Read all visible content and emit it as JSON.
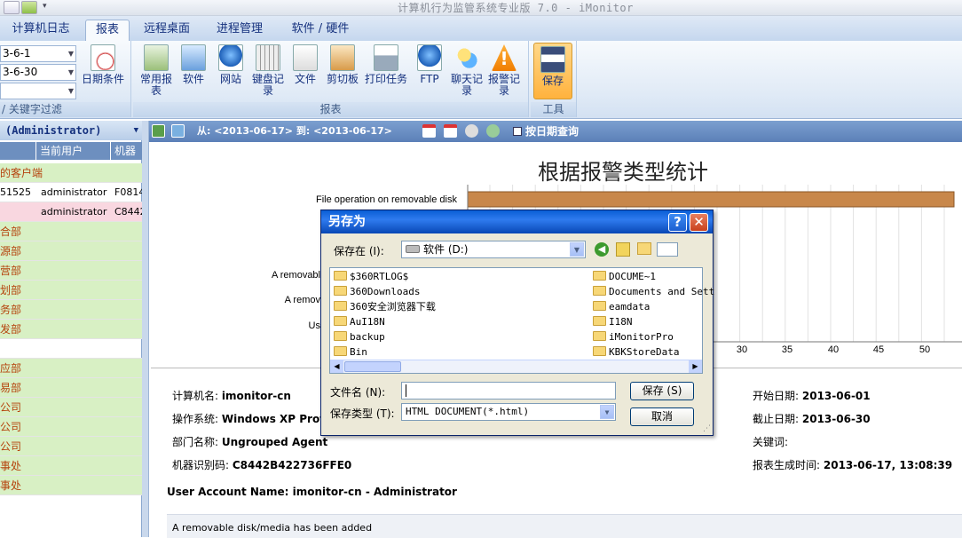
{
  "window": {
    "title": "计算机行为监管系统专业版 7.0 - iMonitor"
  },
  "tabs": [
    "计算机日志",
    "报表",
    "远程桌面",
    "进程管理",
    "软件 / 硬件"
  ],
  "ribbon": {
    "date_start": "3-6-1",
    "date_end": "3-6-30",
    "date_condition": "日期条件",
    "filter_label": "/ 关键字过滤",
    "report_items": [
      "常用报表",
      "软件",
      "网站",
      "键盘记录",
      "文件",
      "剪切板",
      "打印任务",
      "FTP",
      "聊天记录",
      "报警记录"
    ],
    "report_group": "报表",
    "save_label": "保存",
    "tools_group": "工具"
  },
  "left_pane": {
    "header": "(Administrator)",
    "columns": [
      "当前用户",
      "机器识"
    ],
    "rows": [
      {
        "a": "的客户端",
        "b": "",
        "c": "",
        "type": "group"
      },
      {
        "a": "51525",
        "b": "administrator",
        "c": "F0814",
        "type": "normal"
      },
      {
        "a": "",
        "b": "administrator",
        "c": "C8442",
        "type": "pink"
      },
      {
        "a": "合部",
        "b": "",
        "c": "",
        "type": "group"
      },
      {
        "a": "源部",
        "b": "",
        "c": "",
        "type": "group"
      },
      {
        "a": "营部",
        "b": "",
        "c": "",
        "type": "group"
      },
      {
        "a": "划部",
        "b": "",
        "c": "",
        "type": "group"
      },
      {
        "a": "务部",
        "b": "",
        "c": "",
        "type": "group"
      },
      {
        "a": "发部",
        "b": "",
        "c": "",
        "type": "group"
      },
      {
        "a": "",
        "b": "",
        "c": "",
        "type": "blank"
      },
      {
        "a": "应部",
        "b": "",
        "c": "",
        "type": "group"
      },
      {
        "a": "易部",
        "b": "",
        "c": "",
        "type": "group"
      },
      {
        "a": "公司",
        "b": "",
        "c": "",
        "type": "group"
      },
      {
        "a": "公司",
        "b": "",
        "c": "",
        "type": "group"
      },
      {
        "a": "公司",
        "b": "",
        "c": "",
        "type": "group"
      },
      {
        "a": "事处",
        "b": "",
        "c": "",
        "type": "group"
      },
      {
        "a": "事处",
        "b": "",
        "c": "",
        "type": "group"
      }
    ]
  },
  "report_toolbar": {
    "range": "从: <2013-06-17> 到: <2013-06-17>",
    "by_date": "按日期查询"
  },
  "report": {
    "title": "根据报警类型统计",
    "bar_labels": [
      "File operation on removable disk",
      "A removabl",
      "A remov",
      "Us"
    ],
    "x_ticks": [
      "30",
      "35",
      "40",
      "45",
      "50"
    ],
    "info": {
      "computer_name_label": "计算机名:",
      "computer_name": "imonitor-cn",
      "os_label": "操作系统:",
      "os": "Windows XP Profess",
      "dept_label": "部门名称:",
      "dept": "Ungrouped Agent",
      "machine_id_label": "机器识别码:",
      "machine_id": "C8442B422736FFE0",
      "start_label": "开始日期:",
      "start": "2013-06-01",
      "end_label": "截止日期:",
      "end": "2013-06-30",
      "keyword_label": "关键词:",
      "gen_label": "报表生成时间:",
      "gen": "2013-06-17, 13:08:39",
      "user_account": "User Account Name: imonitor-cn - Administrator",
      "event": "A removable disk/media has been added"
    }
  },
  "dialog": {
    "title": "另存为",
    "save_in_label": "保存在 (I):",
    "save_in_value": "软件 (D:)",
    "files_left": [
      "$360RTLOG$",
      "360Downloads",
      "360安全浏览器下载",
      "AuI18N",
      "backup",
      "Bin"
    ],
    "files_right": [
      "DOCUME~1",
      "Documents and Sett",
      "eamdata",
      "I18N",
      "iMonitorPro",
      "KBKStoreData"
    ],
    "filename_label": "文件名 (N):",
    "filename_value": "",
    "filetype_label": "保存类型 (T):",
    "filetype_value": "HTML DOCUMENT(*.html)",
    "save_button": "保存 (S)",
    "cancel_button": "取消"
  },
  "colors": {
    "bar": "#c8874a",
    "bar_border": "#8a5624",
    "accent": "#0a5ed5"
  }
}
